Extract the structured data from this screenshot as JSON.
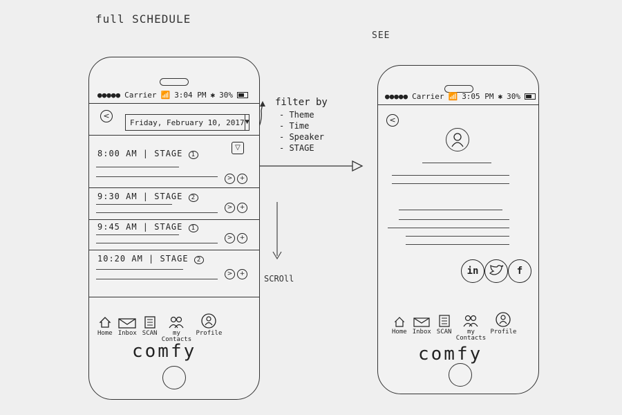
{
  "notes": {
    "title": "full SCHEDULE",
    "see": "SEE",
    "scroll": "SCROll",
    "filter_heading": "filter by",
    "filter_options": [
      "Theme",
      "Time",
      "Speaker",
      "STAGE"
    ]
  },
  "status_bar_left": {
    "carrier": "Carrier",
    "time": "3:04 PM",
    "battery": "30%"
  },
  "status_bar_right": {
    "carrier": "Carrier",
    "time": "3:05 PM",
    "battery": "30%"
  },
  "schedule": {
    "back_icon": "back-icon",
    "date": "Friday, February 10, 2017",
    "dropdown_icon": "caret-down-icon",
    "filter_icon": "filter-icon",
    "sessions": [
      {
        "title": "8:00 AM | STAGE",
        "stage": "1"
      },
      {
        "title": "9:30 AM | STAGE",
        "stage": "2"
      },
      {
        "title": "9:45 AM | STAGE",
        "stage": "1"
      },
      {
        "title": "10:20 AM | STAGE",
        "stage": "2"
      }
    ],
    "detail_icon": "chevron-right-icon",
    "add_icon": "plus-icon"
  },
  "tabs": [
    {
      "label": "Home",
      "icon": "home-icon"
    },
    {
      "label": "Inbox",
      "icon": "mail-icon"
    },
    {
      "label": "SCAN",
      "icon": "scan-icon"
    },
    {
      "label": "my Contacts",
      "icon": "contacts-icon"
    },
    {
      "label": "Profile",
      "icon": "profile-icon"
    }
  ],
  "brand": "comfy",
  "social": [
    {
      "label": "in",
      "icon": "linkedin-icon"
    },
    {
      "label": "",
      "icon": "twitter-icon"
    },
    {
      "label": "f",
      "icon": "facebook-icon"
    }
  ]
}
